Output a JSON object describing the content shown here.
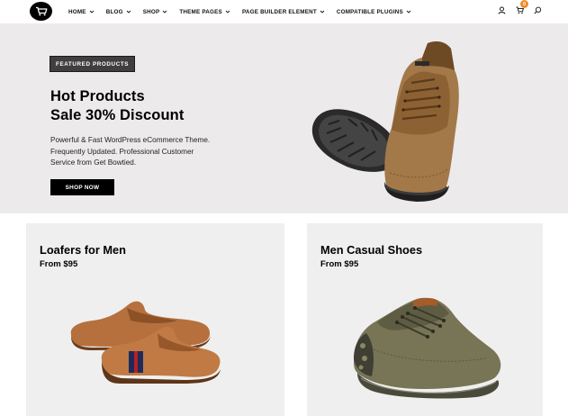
{
  "header": {
    "nav": [
      {
        "label": "HOME"
      },
      {
        "label": "BLOG"
      },
      {
        "label": "SHOP"
      },
      {
        "label": "THEME PAGES"
      },
      {
        "label": "PAGE BUILDER ELEMENT"
      },
      {
        "label": "COMPATIBLE PLUGINS"
      }
    ],
    "cart_count": "0"
  },
  "hero": {
    "badge": "FEATURED PRODUCTS",
    "title_line1": "Hot Products",
    "title_line2": "Sale 30% Discount",
    "desc_line1": "Powerful & Fast WordPress eCommerce Theme.",
    "desc_line2": "Frequently Updated. Professional Customer",
    "desc_line3": "Service from Get Bowtied.",
    "button": "SHOP NOW"
  },
  "cards": [
    {
      "title": "Loafers for Men",
      "price": "From $95"
    },
    {
      "title": "Men Casual Shoes",
      "price": "From $95"
    }
  ],
  "colors": {
    "hero_bg": "#eceaeb",
    "card_bg": "#efefef",
    "cart_badge": "#f08c2a",
    "button_bg": "#000000"
  },
  "icons": [
    "cart-logo-icon",
    "chevron-down-icon",
    "user-icon",
    "cart-icon",
    "search-icon"
  ]
}
